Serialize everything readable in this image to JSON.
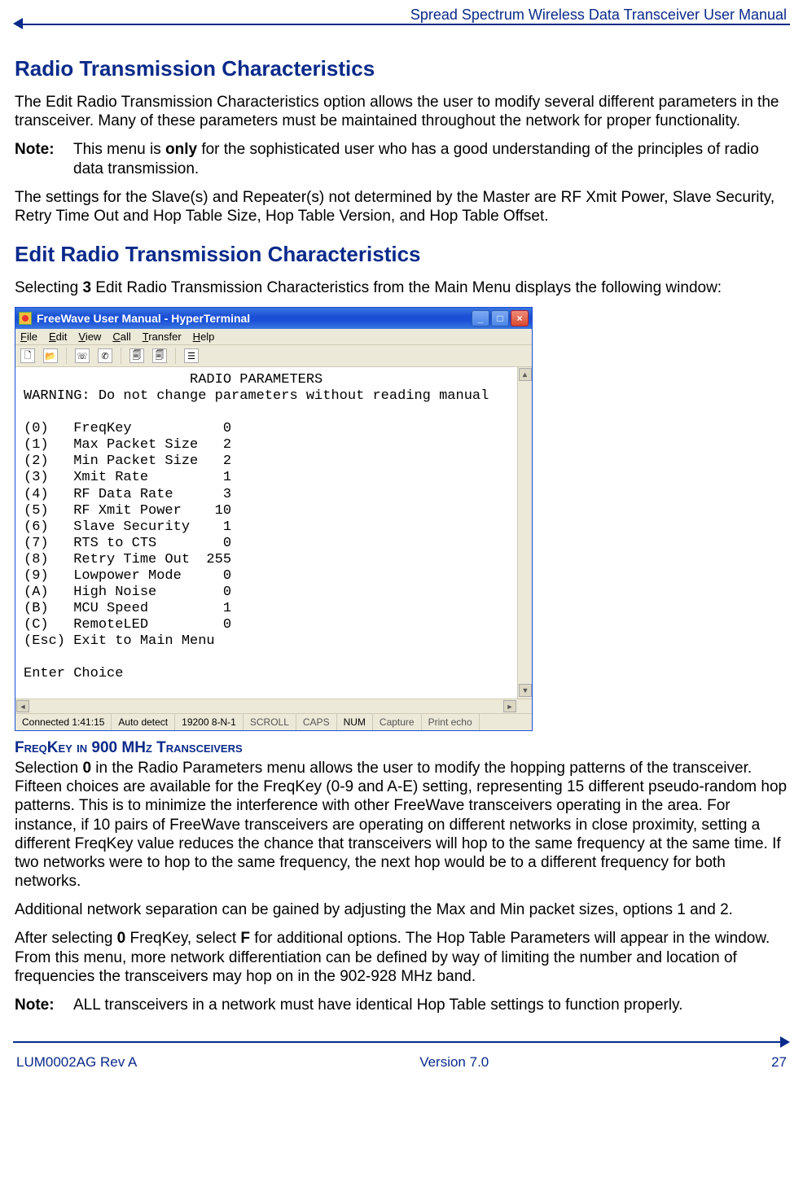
{
  "header": {
    "doc_title": "Spread Spectrum Wireless Data Transceiver User Manual"
  },
  "section1": {
    "heading": "Radio Transmission Characteristics",
    "p1": "The Edit Radio Transmission Characteristics option allows the user to modify several different parameters in the transceiver. Many of these parameters must be maintained throughout the network for proper functionality.",
    "note_label": "Note:",
    "note_pre": "This menu is ",
    "note_bold": "only",
    "note_post": " for the sophisticated user who has a good understanding of the principles of radio data transmission.",
    "p2": "The settings for the Slave(s) and Repeater(s) not determined by the Master are RF Xmit Power, Slave Security, Retry Time Out and Hop Table Size, Hop Table Version, and Hop Table Offset."
  },
  "section2": {
    "heading": "Edit Radio Transmission Characteristics",
    "p1_pre": "Selecting ",
    "p1_bold": "3",
    "p1_post": " Edit Radio Transmission Characteristics from the Main Menu displays the following window:"
  },
  "terminal": {
    "window_title": "FreeWave User Manual - HyperTerminal",
    "menus": [
      "File",
      "Edit",
      "View",
      "Call",
      "Transfer",
      "Help"
    ],
    "screen_title": "RADIO PARAMETERS",
    "warning": "WARNING: Do not change parameters without reading manual",
    "params": [
      {
        "key": "(0)",
        "name": "FreqKey",
        "val": "0"
      },
      {
        "key": "(1)",
        "name": "Max Packet Size",
        "val": "2"
      },
      {
        "key": "(2)",
        "name": "Min Packet Size",
        "val": "2"
      },
      {
        "key": "(3)",
        "name": "Xmit Rate",
        "val": "1"
      },
      {
        "key": "(4)",
        "name": "RF Data Rate",
        "val": "3"
      },
      {
        "key": "(5)",
        "name": "RF Xmit Power",
        "val": "10"
      },
      {
        "key": "(6)",
        "name": "Slave Security",
        "val": "1"
      },
      {
        "key": "(7)",
        "name": "RTS to CTS",
        "val": "0"
      },
      {
        "key": "(8)",
        "name": "Retry Time Out",
        "val": "255"
      },
      {
        "key": "(9)",
        "name": "Lowpower Mode",
        "val": "0"
      },
      {
        "key": "(A)",
        "name": "High Noise",
        "val": "0"
      },
      {
        "key": "(B)",
        "name": "MCU Speed",
        "val": "1"
      },
      {
        "key": "(C)",
        "name": "RemoteLED",
        "val": "0"
      }
    ],
    "esc_line": "(Esc) Exit to Main Menu",
    "prompt": "Enter Choice",
    "status": {
      "connected": "Connected 1:41:15",
      "detect": "Auto detect",
      "baud": "19200 8-N-1",
      "scroll": "SCROLL",
      "caps": "CAPS",
      "num": "NUM",
      "capture": "Capture",
      "echo": "Print echo"
    }
  },
  "section3": {
    "sub_title": "FreqKey in 900 MHz Transceivers",
    "p1_pre": "Selection ",
    "p1_bold": "0",
    "p1_post": " in the Radio Parameters menu allows the user to modify the hopping patterns of the transceiver. Fifteen choices are available for the FreqKey (0-9 and A-E) setting, representing 15 different pseudo-random hop patterns.  This is to minimize the interference with other FreeWave transceivers operating in the area. For instance, if 10 pairs of FreeWave transceivers are operating on different networks in close proximity, setting a different FreqKey value reduces the chance that transceivers will hop to the same frequency at the same time. If two networks were to hop to the same frequency, the next hop would be to a different frequency for both networks.",
    "p2": " Additional network separation can be gained by adjusting the Max and Min packet sizes, options 1 and 2.",
    "p3_pre": "After selecting ",
    "p3_b1": "0",
    "p3_mid": " FreqKey, select ",
    "p3_b2": "F",
    "p3_post": " for additional options. The Hop Table Parameters will appear in the window.  From this menu, more network differentiation can be defined by way of limiting the number and location of frequencies the transceivers may hop on in the 902-928 MHz band.",
    "note_label": "Note:",
    "note_body": "ALL transceivers in a network must have identical Hop Table settings to function properly."
  },
  "footer": {
    "left": "LUM0002AG Rev A",
    "center": "Version 7.0",
    "right": "27"
  }
}
